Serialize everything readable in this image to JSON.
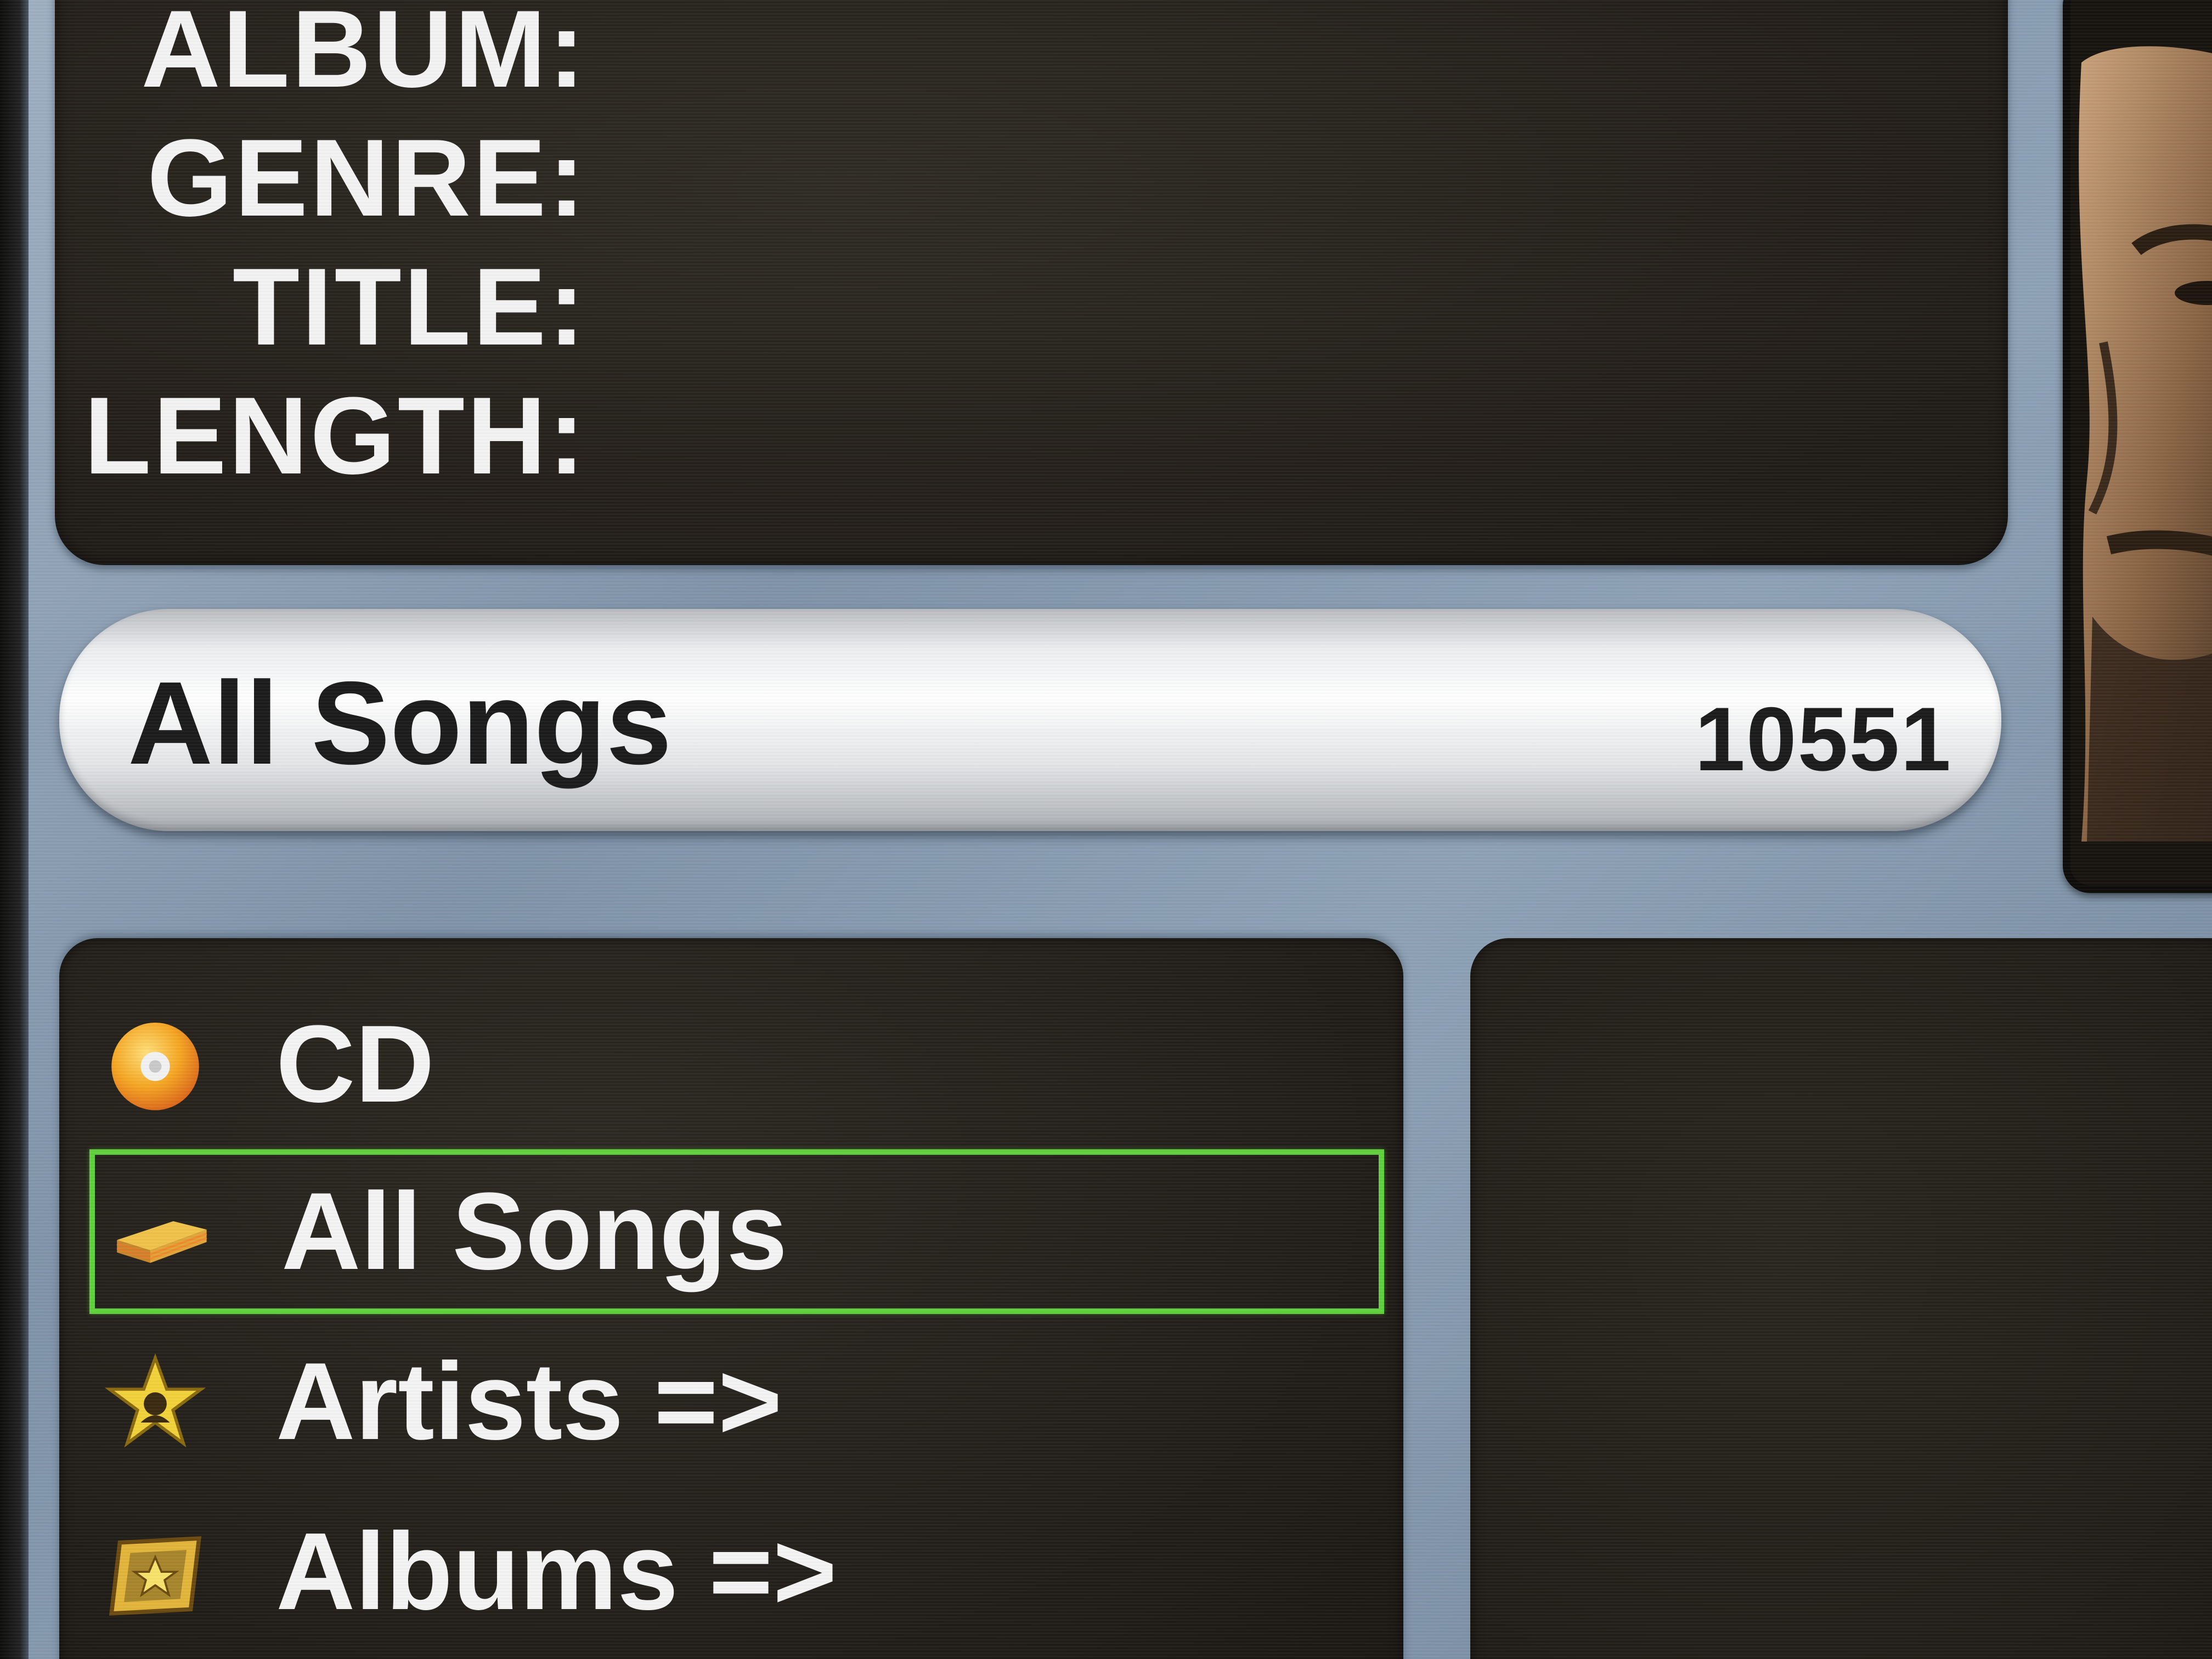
{
  "info": {
    "album_label": "ALBUM:",
    "genre_label": "GENRE:",
    "title_label": "TITLE:",
    "length_label": "LENGTH:",
    "album_value": "",
    "genre_value": "",
    "title_value": "",
    "length_value": ""
  },
  "category_bar": {
    "name": "All Songs",
    "count": "10551"
  },
  "menu": {
    "items": [
      {
        "label": "CD",
        "icon": "cd-icon"
      },
      {
        "label": "All Songs",
        "icon": "stack-icon",
        "selected": true
      },
      {
        "label": "Artists =>",
        "icon": "star-icon"
      },
      {
        "label": "Albums =>",
        "icon": "album-icon"
      }
    ]
  },
  "colors": {
    "selection_border": "#5fd13b",
    "panel_bg": "#241f1a",
    "frame_metal": "#8ea2b6",
    "text_light": "#f4f4f4",
    "text_dark": "#1b1b1b"
  }
}
